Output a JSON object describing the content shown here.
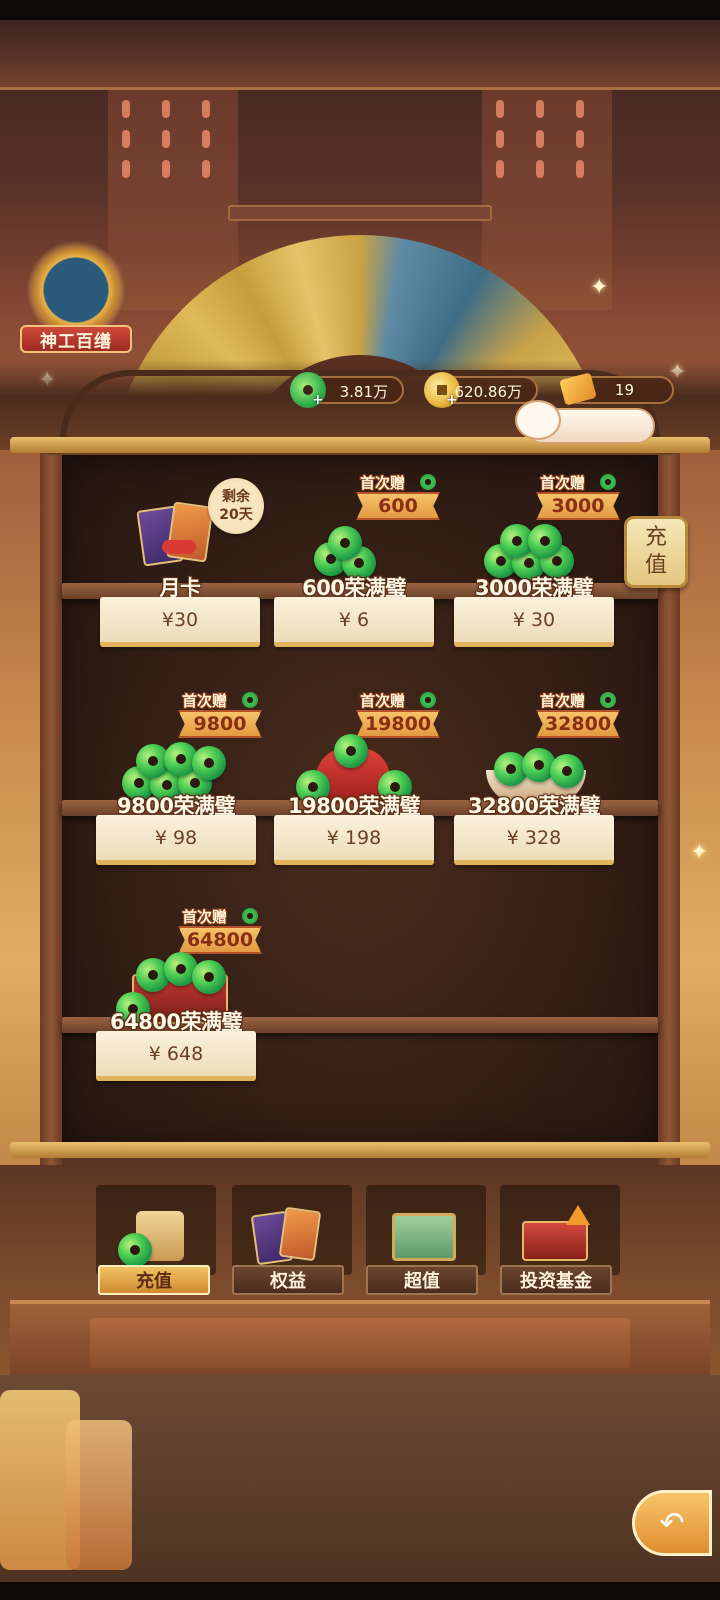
{
  "title_badge": {
    "label": "神工百缮"
  },
  "currencies": [
    {
      "name": "jade-coin",
      "value": "3.81万",
      "has_plus": true
    },
    {
      "name": "gold-coin",
      "value": "620.86万",
      "has_plus": true
    },
    {
      "name": "ticket",
      "value": "19",
      "has_plus": false
    }
  ],
  "side_button": {
    "line1": "充",
    "line2": "值"
  },
  "monthly_card": {
    "name": "月卡",
    "price": "¥30",
    "remain_line1": "剩余",
    "remain_line2": "20天"
  },
  "products": [
    {
      "name": "600荣满璧",
      "price": "¥ 6",
      "gift_label": "首次赠",
      "gift_amount": "600"
    },
    {
      "name": "3000荣满璧",
      "price": "¥ 30",
      "gift_label": "首次赠",
      "gift_amount": "3000"
    },
    {
      "name": "9800荣满璧",
      "price": "¥ 98",
      "gift_label": "首次赠",
      "gift_amount": "9800"
    },
    {
      "name": "19800荣满璧",
      "price": "¥ 198",
      "gift_label": "首次赠",
      "gift_amount": "19800"
    },
    {
      "name": "32800荣满璧",
      "price": "¥ 328",
      "gift_label": "首次赠",
      "gift_amount": "32800"
    },
    {
      "name": "64800荣满璧",
      "price": "¥ 648",
      "gift_label": "首次赠",
      "gift_amount": "64800"
    }
  ],
  "tabs": [
    {
      "label": "充值",
      "active": true
    },
    {
      "label": "权益",
      "active": false
    },
    {
      "label": "超值",
      "active": false
    },
    {
      "label": "投资基金",
      "active": false
    }
  ],
  "colors": {
    "active_tab": "#e5a847",
    "price_card": "#f6e8cc",
    "jade": "#3fbf55"
  }
}
